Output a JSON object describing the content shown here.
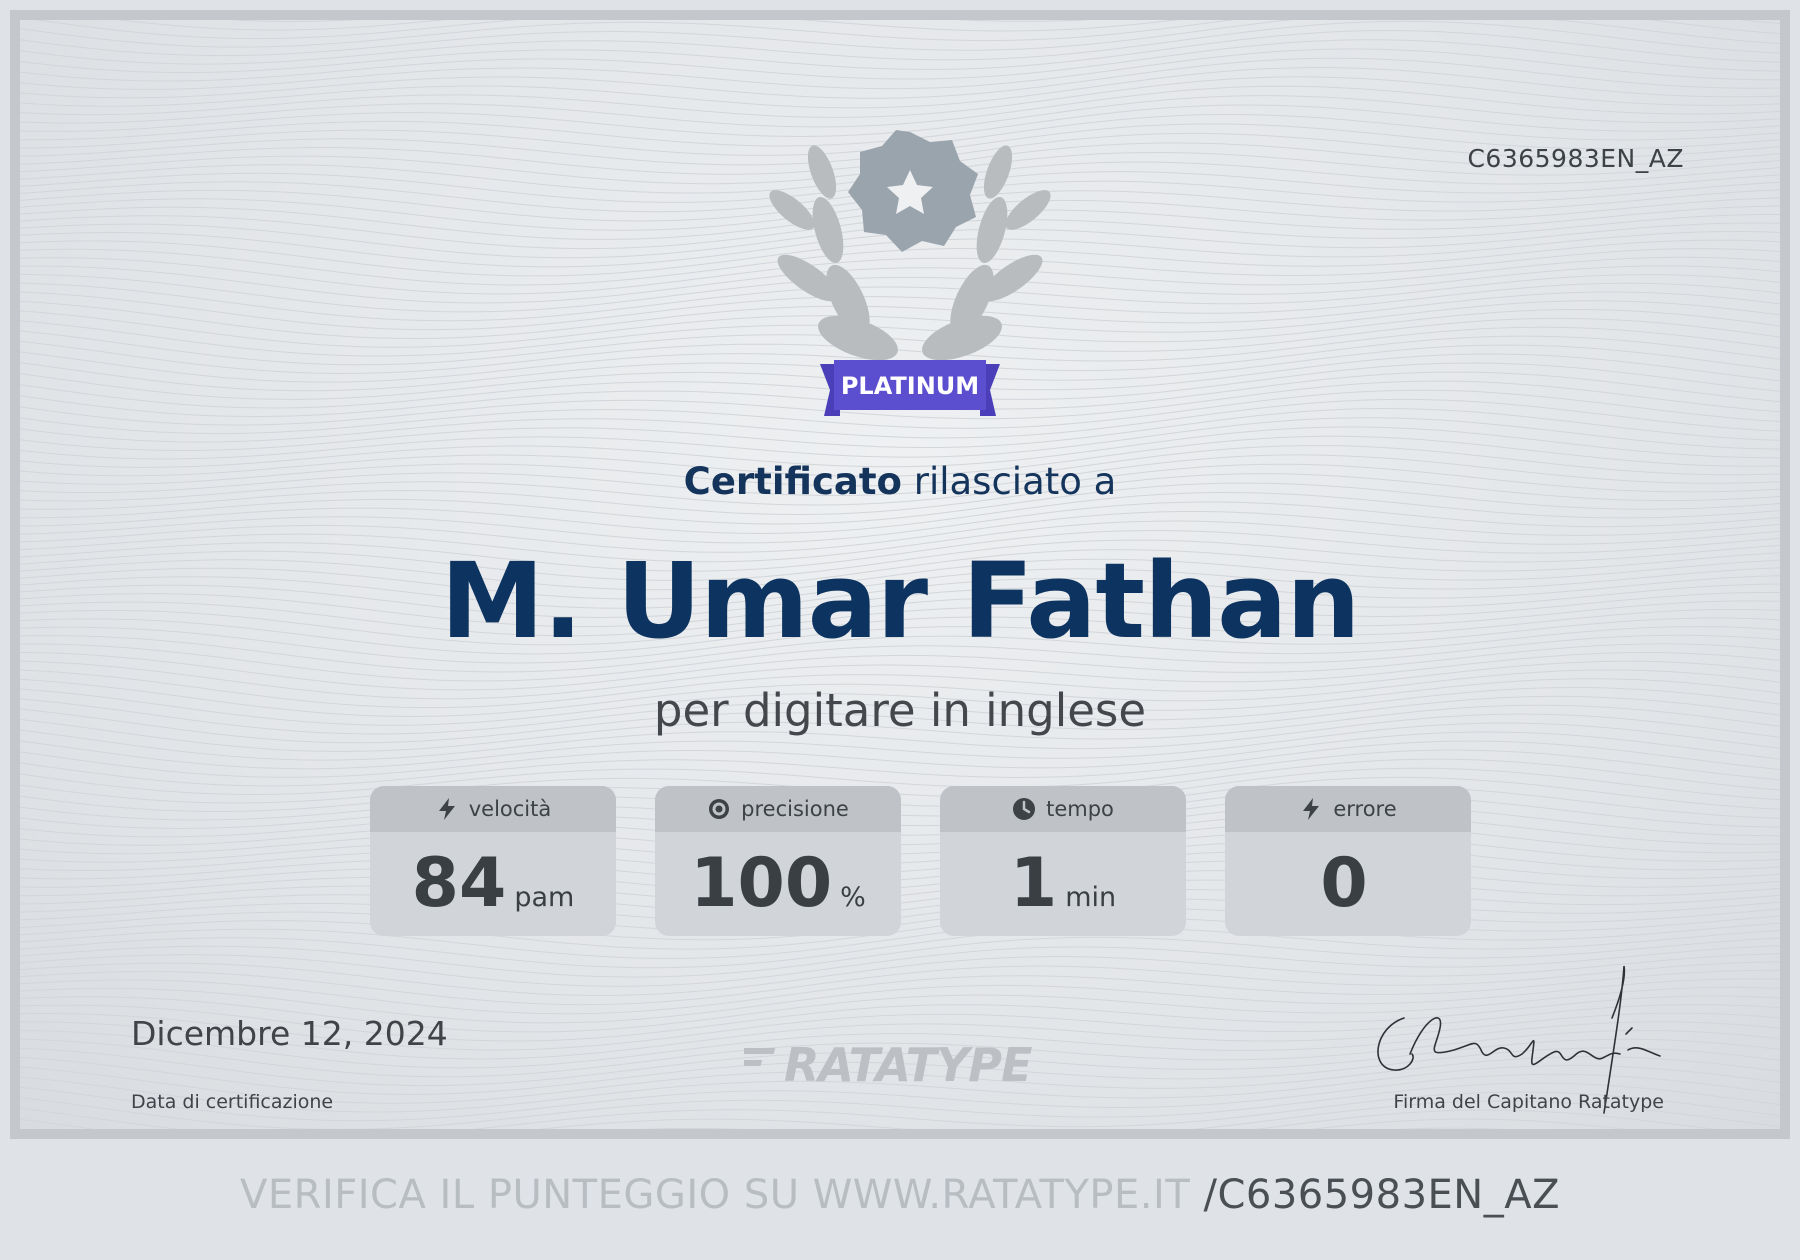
{
  "certificate": {
    "code": "C6365983EN_AZ",
    "level": "PLATINUM",
    "title_strong": "Certificato",
    "title_rest": " rilasciato a",
    "recipient": "M. Umar Fathan",
    "subject": "per digitare in inglese"
  },
  "stats": [
    {
      "label": "velocità",
      "icon": "lightning-icon",
      "value": "84",
      "unit": "pam"
    },
    {
      "label": "precisione",
      "icon": "target-icon",
      "value": "100",
      "unit": "%"
    },
    {
      "label": "tempo",
      "icon": "clock-icon",
      "value": "1",
      "unit": "min"
    },
    {
      "label": "errore",
      "icon": "lightning-icon",
      "value": "0",
      "unit": ""
    }
  ],
  "footer": {
    "date": "Dicembre 12, 2024",
    "date_label": "Data di certificazione",
    "brand": "RATATYPE",
    "signature_label": "Firma del Capitano Ratatype",
    "signature_text": "CRatatype"
  },
  "verify": {
    "prefix": "VERIFICA IL PUNTEGGIO SU WWW.RATATYPE.IT ",
    "code": "/C6365983EN_AZ"
  },
  "colors": {
    "name": "#0d3460",
    "ribbon": "#5b4fd0",
    "medal": "#9aa4ad",
    "laurel": "#b9bcbf"
  }
}
